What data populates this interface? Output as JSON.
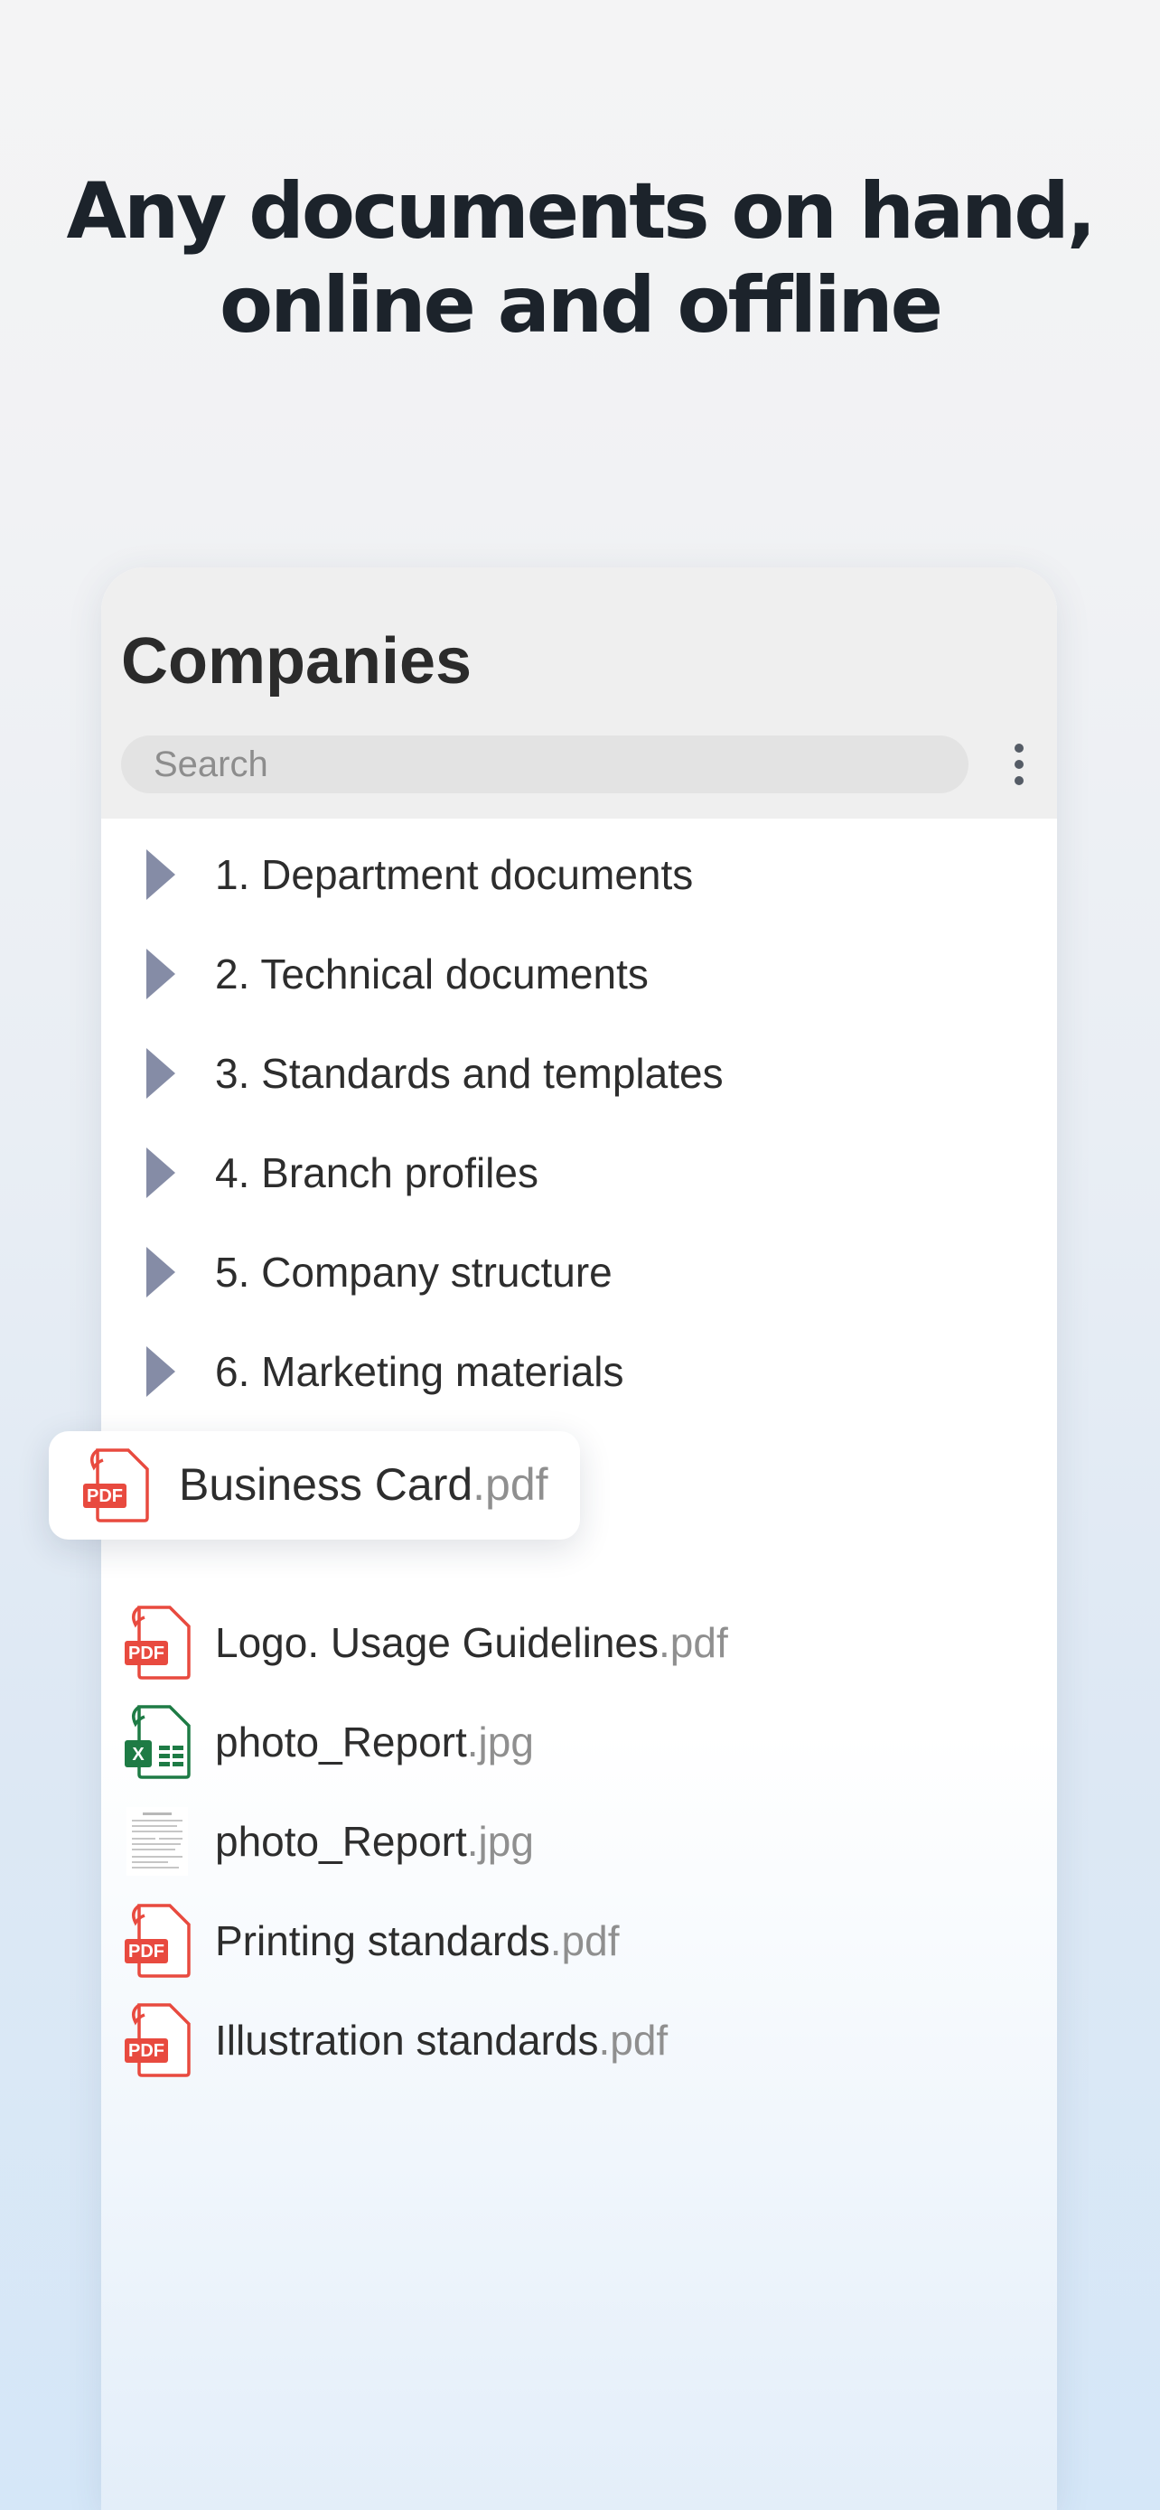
{
  "headline": {
    "line1": "Any documents on hand,",
    "line2": "online and offline"
  },
  "panel": {
    "title": "Companies",
    "search_placeholder": "Search",
    "menu_icon": "more-vertical-icon"
  },
  "folders": [
    {
      "label": "1. Department documents",
      "icon": "folder-expand-arrow-icon"
    },
    {
      "label": "2. Technical documents",
      "icon": "folder-expand-arrow-icon"
    },
    {
      "label": "3. Standards and templates",
      "icon": "folder-expand-arrow-icon"
    },
    {
      "label": "4. Branch profiles",
      "icon": "folder-expand-arrow-icon"
    },
    {
      "label": "5. Company structure",
      "icon": "folder-expand-arrow-icon"
    },
    {
      "label": "6. Marketing materials",
      "icon": "folder-expand-arrow-icon"
    }
  ],
  "dragged_file": {
    "name": "Business Card",
    "ext": ".pdf",
    "icon": "pdf-file-icon"
  },
  "files": [
    {
      "name": "Logo. Usage Guidelines",
      "ext": ".pdf",
      "icon": "pdf-file-icon"
    },
    {
      "name": "photo_Report",
      "ext": ".jpg",
      "icon": "spreadsheet-file-icon"
    },
    {
      "name": "photo_Report",
      "ext": ".jpg",
      "icon": "document-thumbnail-icon"
    },
    {
      "name": "Printing standards",
      "ext": ".pdf",
      "icon": "pdf-file-icon"
    },
    {
      "name": "Illustration standards",
      "ext": ".pdf",
      "icon": "pdf-file-icon"
    }
  ],
  "icon_text": {
    "pdf": "PDF",
    "excel": "X"
  },
  "colors": {
    "headline": "#1c232b",
    "folder_arrow": "#858ca6",
    "pdf_red": "#e84a3f",
    "excel_green": "#1e7b45",
    "extension_gray": "#8f8f8f"
  }
}
